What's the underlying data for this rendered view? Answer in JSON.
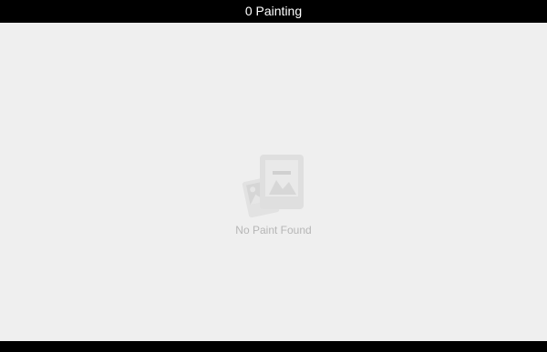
{
  "header": {
    "title": "0 Painting"
  },
  "empty_state": {
    "icon": "gallery-photos-icon",
    "message": "No Paint Found"
  },
  "colors": {
    "bar_background": "#000000",
    "page_background": "#efefef",
    "header_text": "#ffffff",
    "empty_text": "#b6b6b6",
    "empty_icon": "#dcdcdc"
  }
}
